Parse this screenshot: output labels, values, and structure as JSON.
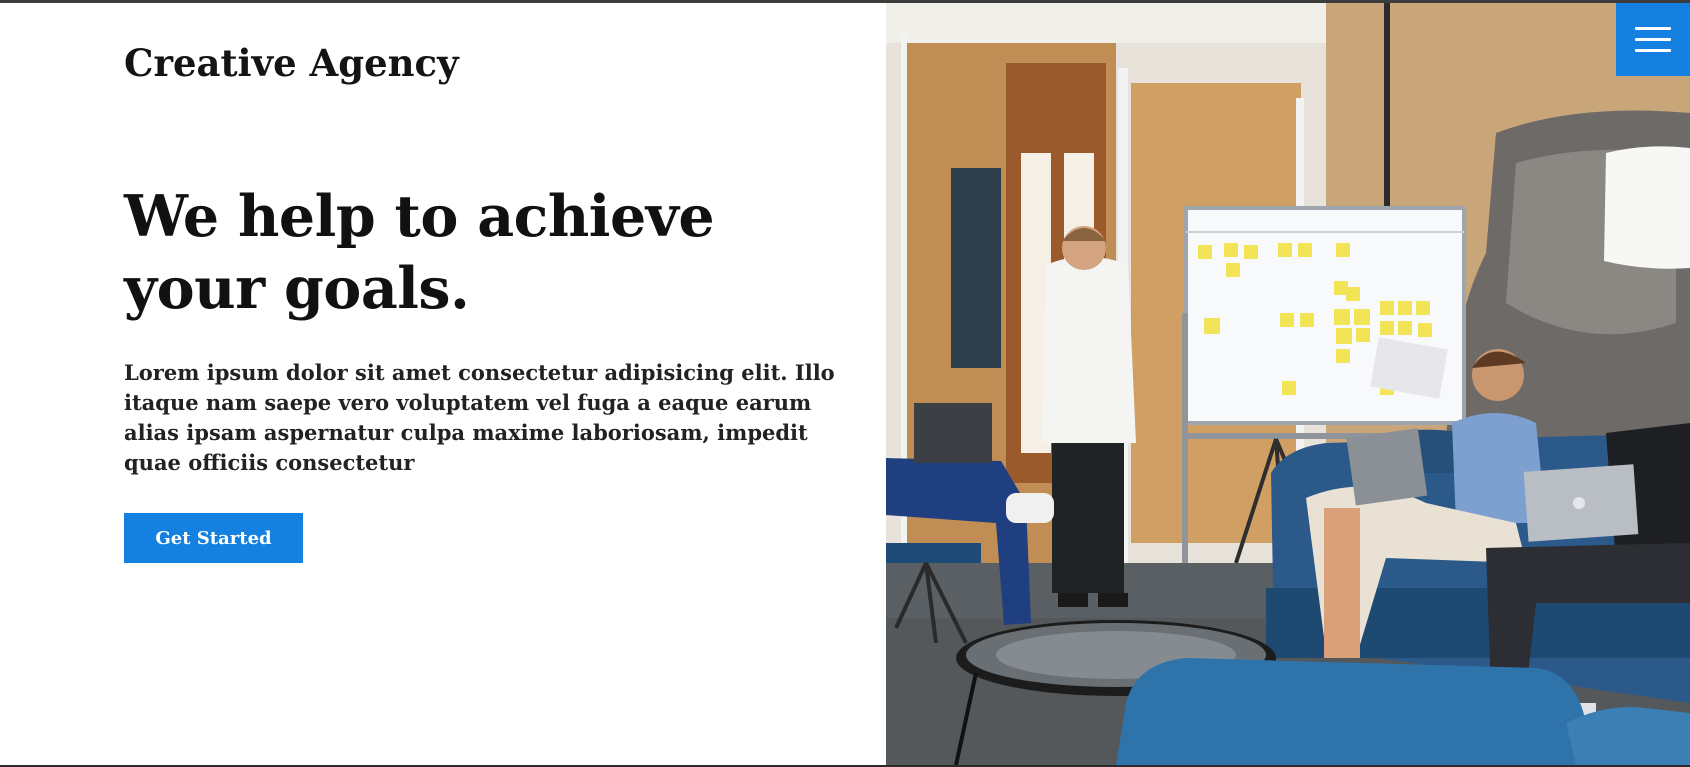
{
  "brand": {
    "name": "Creative Agency"
  },
  "hero": {
    "headline_line1": "We help to achieve",
    "headline_line2": "your goals.",
    "lead": "Lorem ipsum dolor sit amet consectetur adipisicing elit. Illo itaque nam saepe vero voluptatem vel fuga a eaque earum alias ipsam aspernatur culpa maxime laboriosam, impedit quae officiis consectetur",
    "cta_label": "Get Started"
  },
  "menu": {
    "icon": "hamburger-menu-icon"
  },
  "colors": {
    "accent": "#1480df",
    "text": "#111111",
    "background": "#ffffff"
  }
}
